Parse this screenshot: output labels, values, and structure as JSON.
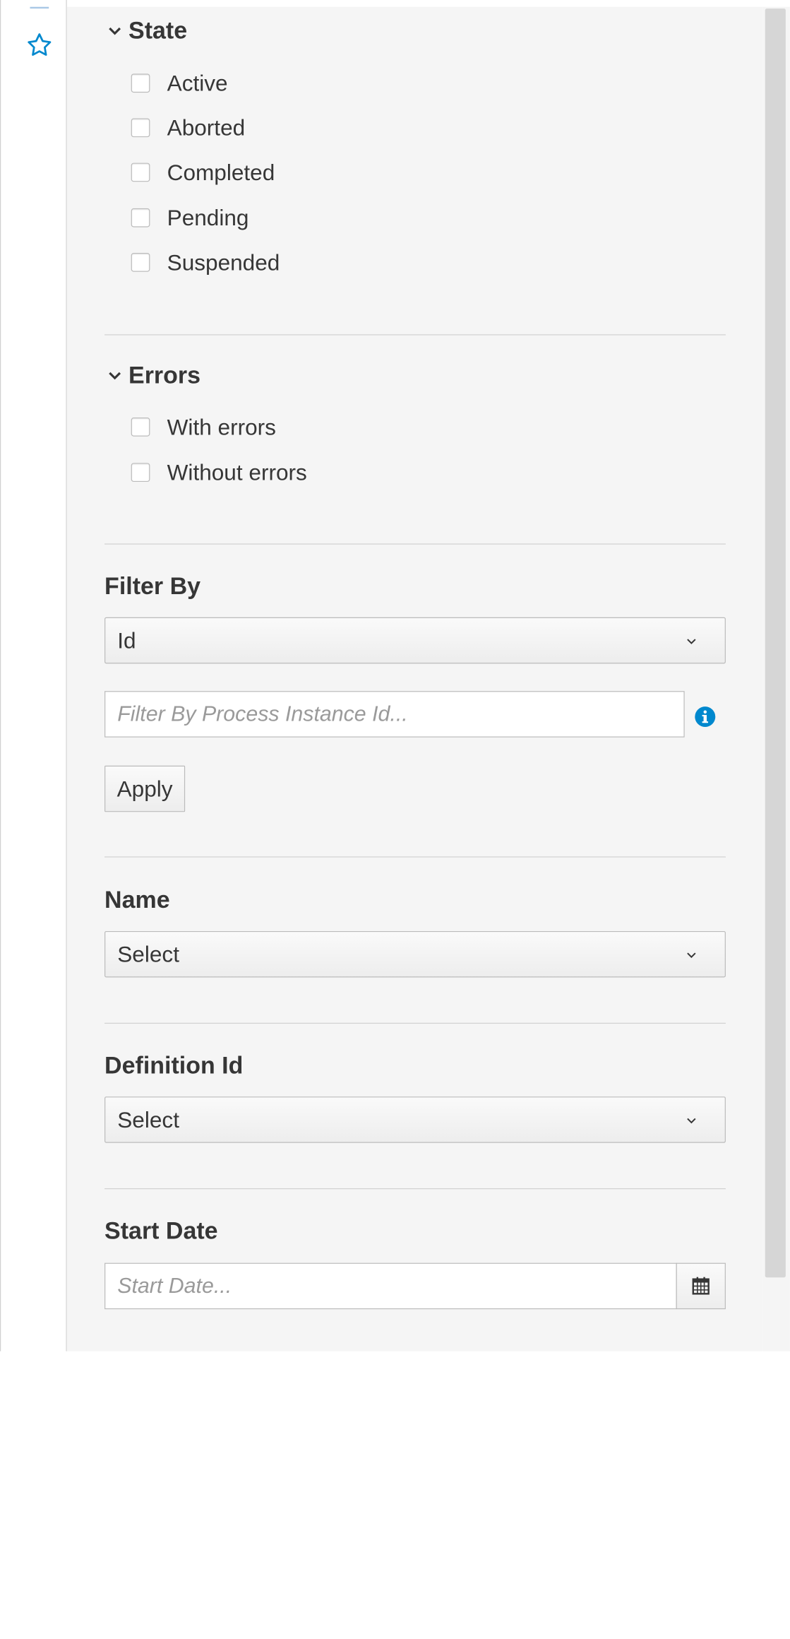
{
  "state_section": {
    "title": "State",
    "options": [
      "Active",
      "Aborted",
      "Completed",
      "Pending",
      "Suspended"
    ]
  },
  "errors_section": {
    "title": "Errors",
    "options": [
      "With errors",
      "Without errors"
    ]
  },
  "filter_by": {
    "label": "Filter By",
    "selected": "Id",
    "input_placeholder": "Filter By Process Instance Id...",
    "apply_label": "Apply"
  },
  "name_filter": {
    "label": "Name",
    "selected": "Select"
  },
  "definition_filter": {
    "label": "Definition Id",
    "selected": "Select"
  },
  "start_date": {
    "label": "Start Date",
    "placeholder": "Start Date..."
  },
  "icons": {
    "favorite": "star-icon",
    "collapse": "chevron-down-icon",
    "info": "info-icon",
    "calendar": "calendar-icon"
  },
  "colors": {
    "accent": "#0088ce",
    "panel_bg": "#f5f5f5",
    "text": "#363636"
  }
}
